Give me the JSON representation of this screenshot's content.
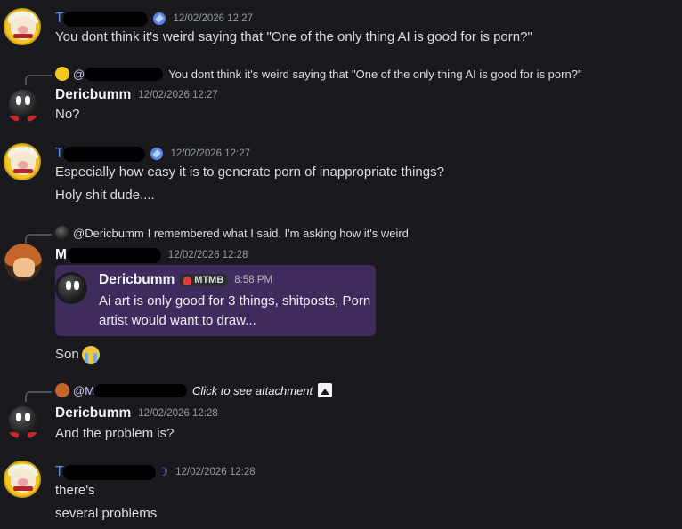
{
  "messages": [
    {
      "username": "T",
      "timestamp": "12/02/2026 12:27",
      "lines": [
        "You dont think it's weird saying that \"One of the only thing AI is good for is porn?\""
      ]
    },
    {
      "reply": {
        "mention": "@",
        "text": "You dont think it's weird saying that \"One of the only thing AI is good for is porn?\""
      },
      "username": "Dericbumm",
      "timestamp": "12/02/2026 12:27",
      "lines": [
        "No?"
      ]
    },
    {
      "username": "T",
      "timestamp": "12/02/2026 12:27",
      "lines": [
        "Especially  how easy it is to generate porn of inappropriate things?",
        "Holy shit dude...."
      ]
    },
    {
      "reply": {
        "mention": "@Dericbumm",
        "text": "I remembered what I said. I'm asking how it's weird"
      },
      "username": "M",
      "timestamp": "12/02/2026 12:28",
      "embed": {
        "username": "Dericbumm",
        "tag": "MTMB",
        "time": "8:58 PM",
        "text": "Ai art is only good for 3 things, shitposts, Porn artist would want to draw..."
      },
      "lines": [
        "Son"
      ]
    },
    {
      "reply": {
        "mention": "@M",
        "text": "Click to see attachment"
      },
      "username": "Dericbumm",
      "timestamp": "12/02/2026 12:28",
      "lines": [
        "And the problem is?"
      ]
    },
    {
      "username": "T",
      "timestamp": "12/02/2026 12:28",
      "lines": [
        "there's",
        "several problems"
      ]
    }
  ]
}
